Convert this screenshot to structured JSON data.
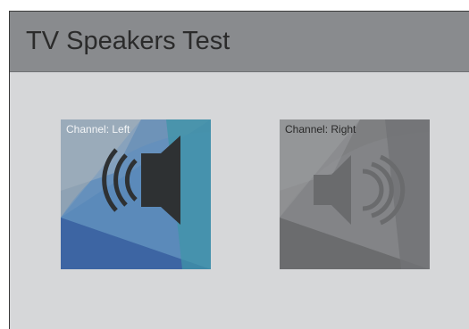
{
  "header": {
    "title": "TV Speakers Test"
  },
  "channels": [
    {
      "label": "Channel: Left",
      "state": "active",
      "icon": "speaker-left-icon"
    },
    {
      "label": "Channel: Right",
      "state": "inactive",
      "icon": "speaker-right-icon"
    }
  ],
  "colors": {
    "header_bg": "#898b8e",
    "body_bg": "#d6d7d9",
    "active_tile": "#4a7fb0",
    "inactive_tile": "#7c7d7f"
  }
}
